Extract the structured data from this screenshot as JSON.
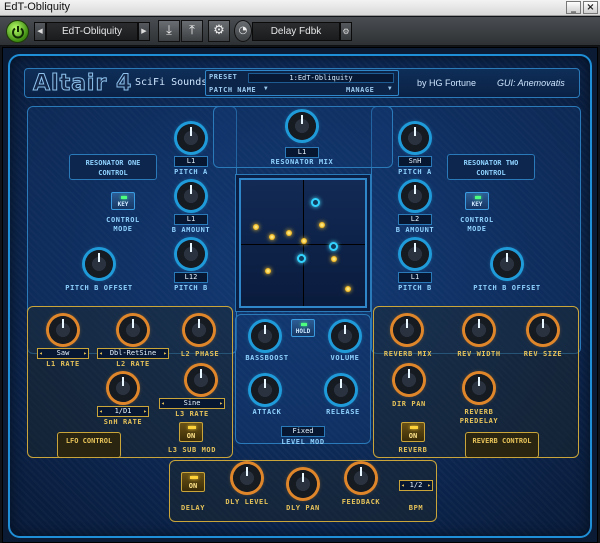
{
  "window": {
    "title": "EdT-Obliquity",
    "minimize_glyph": "_",
    "close_glyph": "×"
  },
  "hostbar": {
    "preset_name": "EdT-Obliquity",
    "param_name": "Delay Fdbk",
    "power_color": "#4caf1a"
  },
  "header": {
    "logo": "Altair 4",
    "logo_sub": "SciFi Sounds Lab",
    "preset_label": "PRESET",
    "preset_value": "1:EdT-Obliquity",
    "patch_name_label": "PATCH NAME",
    "manage_label": "MANAGE",
    "credit": "by HG Fortune",
    "gui_credit": "GUI: Anemovatis"
  },
  "resonator": {
    "mix_display": "L1",
    "mix_label": "RESONATOR MIX",
    "one": {
      "title": "RESONATOR ONE CONTROL",
      "key_label": "KEY",
      "control_mode_label": "CONTROL MODE",
      "pitch_a_display": "L1",
      "pitch_a_label": "PITCH A",
      "b_amount_display": "L1",
      "b_amount_label": "B AMOUNT",
      "pitch_b_display": "L12",
      "pitch_b_label": "PITCH B",
      "pitch_b_offset_label": "PITCH B OFFSET"
    },
    "two": {
      "title": "RESONATOR TWO CONTROL",
      "key_label": "KEY",
      "control_mode_label": "CONTROL MODE",
      "pitch_a_display": "SnH",
      "pitch_a_label": "PITCH A",
      "b_amount_display": "L2",
      "b_amount_label": "B AMOUNT",
      "pitch_b_display": "L1",
      "pitch_b_label": "PITCH B",
      "pitch_b_offset_label": "PITCH B OFFSET"
    }
  },
  "center": {
    "hold_label": "HOLD",
    "bassboost_label": "BASSBOOST",
    "volume_label": "VOLUME",
    "attack_label": "ATTACK",
    "release_label": "RELEASE",
    "level_mod_display": "Fixed",
    "level_mod_label": "LEVEL MOD"
  },
  "lfo": {
    "l1_rate_display": "Saw",
    "l1_rate_label": "L1 RATE",
    "l2_rate_display": "Dbl-RetSine",
    "l2_rate_label": "L2 RATE",
    "l2_phase_label": "L2 PHASE",
    "snh_rate_display": "1/D1",
    "snh_rate_label": "SnH RATE",
    "l3_rate_display": "Sine",
    "l3_rate_label": "L3 RATE",
    "l3_sub_mod_button": "ON",
    "l3_sub_mod_label": "L3 SUB MOD",
    "control_label": "LFO CONTROL"
  },
  "reverb": {
    "mix_label": "REVERB MIX",
    "width_label": "REV WIDTH",
    "size_label": "REV SIZE",
    "dir_pan_label": "DIR PAN",
    "predelay_label": "REVERB PREDELAY",
    "on_button": "ON",
    "reverb_label": "REVERB",
    "control_label": "REVERB CONTROL"
  },
  "delay": {
    "on_button": "ON",
    "delay_label": "DELAY",
    "level_label": "DLY LEVEL",
    "pan_label": "DLY PAN",
    "feedback_label": "FEEDBACK",
    "bpm_display": "1/2",
    "bpm_label": "BPM"
  },
  "colors": {
    "accent_blue": "#1f9bd9",
    "accent_gold": "#c9a53a",
    "knob_orange": "#e0862a"
  }
}
